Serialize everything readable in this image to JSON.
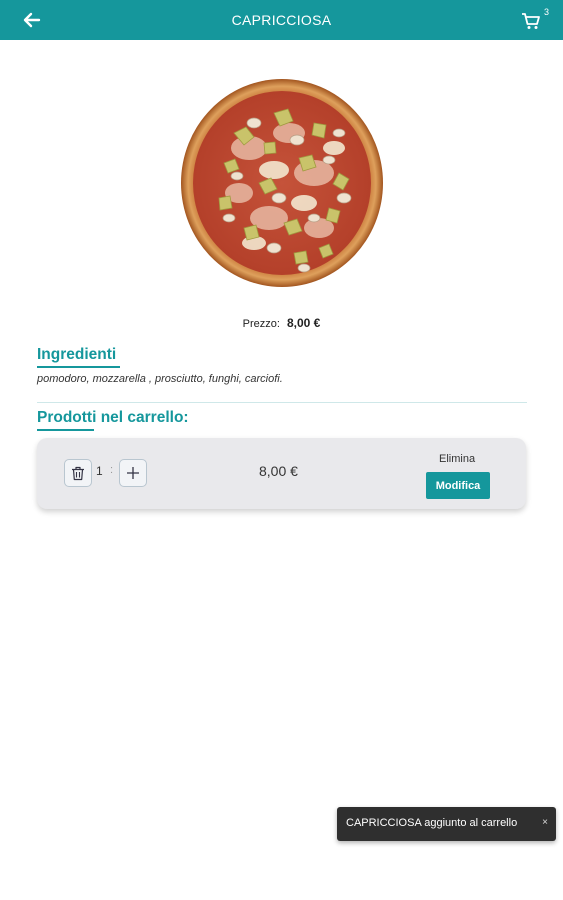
{
  "header": {
    "title": "CAPRICCIOSA",
    "cart_count": "3",
    "back_icon": "arrow-left-icon",
    "cart_icon": "cart-icon"
  },
  "product": {
    "price_label": "Prezzo:",
    "price_value": "8,00 €"
  },
  "ingredients": {
    "title": "Ingredienti",
    "text": "pomodoro, mozzarella , prosciutto, funghi, carciofi."
  },
  "cart_section": {
    "title": "Prodotti nel carrello:",
    "items": [
      {
        "quantity": "1",
        "separator": ":",
        "price": "8,00 €",
        "delete_label": "Elimina",
        "edit_label": "Modifica"
      }
    ]
  },
  "toast": {
    "message": "CAPRICCIOSA aggiunto al carrello",
    "close": "×"
  },
  "colors": {
    "accent": "#15979c",
    "card_bg": "#e9e9ec",
    "toast_bg": "#2f2f2f"
  }
}
